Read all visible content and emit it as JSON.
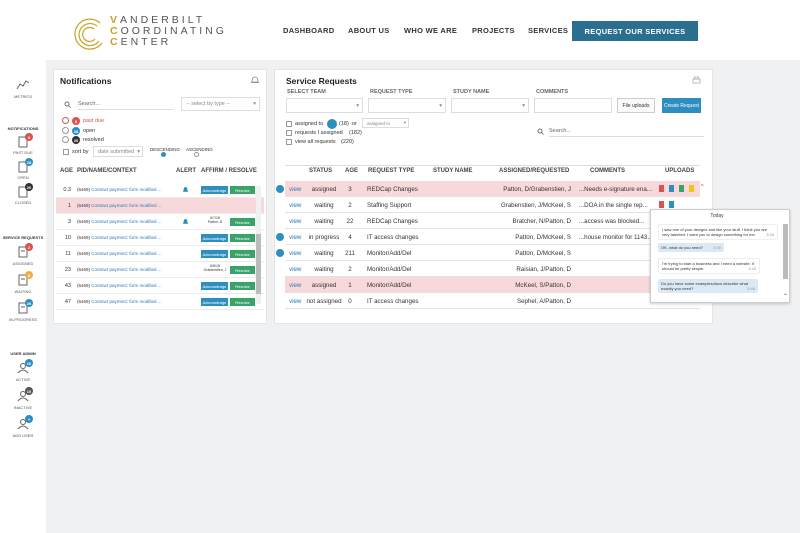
{
  "brand": {
    "line1": "VANDERBILT",
    "line2": "COORDINATING",
    "line3": "CENTER",
    "accent_color": "#c9a227"
  },
  "nav": {
    "items": [
      "DASHBOARD",
      "ABOUT US",
      "WHO WE ARE",
      "PROJECTS",
      "SERVICES"
    ],
    "cta": "REQUEST OUR SERVICES",
    "cta_color": "#2a6f8f"
  },
  "sidebar": {
    "metrics": "METRICS",
    "notifications_heading": "NOTIFICATIONS",
    "notifications": [
      {
        "label": "PAST DUE",
        "count": "8",
        "color": "#d9534f"
      },
      {
        "label": "OPEN",
        "count": "28",
        "color": "#2f8ec0"
      },
      {
        "label": "CLOSED",
        "count": "20",
        "color": "#333333"
      }
    ],
    "service_heading": "SERVICE REQUESTS",
    "service": [
      {
        "label": "ASSIGNED",
        "count": "2",
        "color": "#d9534f"
      },
      {
        "label": "WAITING",
        "count": "8",
        "color": "#f0ad4e"
      },
      {
        "label": "IN-PROGRESS",
        "count": "20",
        "color": "#2f8ec0"
      }
    ],
    "admin_heading": "USER ADMIN",
    "admin": [
      {
        "label": "ACTIVE",
        "count": "10",
        "color": "#2f8ec0"
      },
      {
        "label": "INACTIVE",
        "count": "10",
        "color": "#555555"
      },
      {
        "label": "ADD USER",
        "count": "+",
        "color": "#2f8ec0"
      }
    ]
  },
  "notifications": {
    "title": "Notifications",
    "search_placeholder": "Search...",
    "type_placeholder": "-- select by type --",
    "filters": [
      {
        "count": "8",
        "label": "past due"
      },
      {
        "count": "28",
        "label": "open"
      },
      {
        "count": "20",
        "label": "resolved"
      }
    ],
    "sort_label": "sort by",
    "sort_value": "date submitted",
    "descending": "DESCENDING",
    "ascending": "ASCENDING",
    "columns": [
      "AGE",
      "PID/NAME/CONTEXT",
      "ALERT",
      "AFFIRM / RESOLVE"
    ],
    "ack_label": "Acknowledge",
    "resolve_label": "Resolve",
    "rows": [
      {
        "age": "0.3",
        "pid": "(6469)",
        "ctx": "Contract payment: form modified ...",
        "alert": true,
        "affirm": "ack"
      },
      {
        "age": "1",
        "pid": "(6469)",
        "ctx": "Contract payment: form modified ...",
        "alert": false,
        "affirm": "none"
      },
      {
        "age": "3",
        "pid": "(6469)",
        "ctx": "Contract payment: form modified ...",
        "alert": true,
        "affirm": "signed",
        "sig1": "6/7/18",
        "sig2": "Patton, D"
      },
      {
        "age": "10",
        "pid": "(6469)",
        "ctx": "Contract payment: form modified ...",
        "alert": false,
        "affirm": "ack"
      },
      {
        "age": "11",
        "pid": "(6469)",
        "ctx": "Contract payment: form modified ...",
        "alert": false,
        "affirm": "ack"
      },
      {
        "age": "23",
        "pid": "(6469)",
        "ctx": "Contract payment: form modified ...",
        "alert": false,
        "affirm": "signed",
        "sig1": "6/8/18",
        "sig2": "Grabenstien, J"
      },
      {
        "age": "43",
        "pid": "(6469)",
        "ctx": "Contract payment: form modified ...",
        "alert": false,
        "affirm": "ack"
      },
      {
        "age": "47",
        "pid": "(6469)",
        "ctx": "Contract payment: form modified ...",
        "alert": false,
        "affirm": "ack"
      }
    ]
  },
  "services": {
    "title": "Service Requests",
    "filters": {
      "team": "SELECT TEAM",
      "type": "REQUEST TYPE",
      "study": "STUDY NAME",
      "comments": "COMMENTS"
    },
    "file_uploads": "File uploads",
    "create_request": "Create Request",
    "assigned_to": "assigned to",
    "assigned_count": "(18)",
    "or": "or",
    "assigned_select": "assigned to",
    "requests_assigned": "requests I assigned",
    "requests_assigned_count": "(182)",
    "view_all": "view all requests",
    "view_all_count": "(220)",
    "search_placeholder": "Search...",
    "columns": [
      "STATUS",
      "AGE",
      "REQUEST TYPE",
      "STUDY NAME",
      "ASSIGNED/REQUESTED",
      "COMMENTS",
      "UPLOADS"
    ],
    "view_label": "view",
    "rows": [
      {
        "status": "assigned",
        "age": "3",
        "type": "REDCap Changes",
        "assigned": "Patton, D/Grabenstien, J",
        "comment": "...Needs e-signature ena...",
        "pink": true,
        "bubble": true,
        "uploads": 4
      },
      {
        "status": "waiting",
        "age": "2",
        "type": "Staffing Support",
        "assigned": "Grabenstien, J/McKeel, S",
        "comment": "...DOA in the single rep...",
        "pink": false,
        "bubble": false,
        "uploads": 2
      },
      {
        "status": "waiting",
        "age": "22",
        "type": "REDCap Changes",
        "assigned": "Bratcher, N/Patton, D",
        "comment": "...access was blocked...",
        "pink": false,
        "bubble": false,
        "uploads": 0
      },
      {
        "status": "in progress",
        "age": "4",
        "type": "IT access changes",
        "assigned": "Patton, D/McKeel, S",
        "comment": "...house monitor for 1143...",
        "pink": false,
        "bubble": true,
        "uploads": 0
      },
      {
        "status": "waiting",
        "age": "211",
        "type": "Monitor/Add/Del",
        "assigned": "Patton, D/McKeel, S",
        "comment": "",
        "pink": false,
        "bubble": true,
        "uploads": 0
      },
      {
        "status": "waiting",
        "age": "2",
        "type": "Monitor/Add/Del",
        "assigned": "Raisian, J/Patton, D",
        "comment": "",
        "pink": false,
        "bubble": false,
        "uploads": 0
      },
      {
        "status": "assigned",
        "age": "1",
        "type": "Monitor/Add/Del",
        "assigned": "McKeel, S/Patton, D",
        "comment": "",
        "pink": true,
        "bubble": false,
        "uploads": 0
      },
      {
        "status": "not assigned",
        "age": "0",
        "type": "IT access changes",
        "assigned": "Sephel, A/Patton, D",
        "comment": "",
        "pink": false,
        "bubble": false,
        "uploads": 0
      }
    ]
  },
  "chat": {
    "day": "Today",
    "messages": [
      {
        "text": "I saw one of your designs and like your stuff. I think you are very talented. I want you to design something for me.",
        "time": "3:45",
        "side": "left"
      },
      {
        "text": "OK, what do you need?",
        "time": "3:45",
        "side": "right"
      },
      {
        "text": "I'm trying to start a business and I need a website. It should be pretty simple.",
        "time": "3:45",
        "side": "left"
      },
      {
        "text": "Do you have some examples/docs describe what exactly you need?",
        "time": "3:46",
        "side": "right"
      }
    ]
  }
}
